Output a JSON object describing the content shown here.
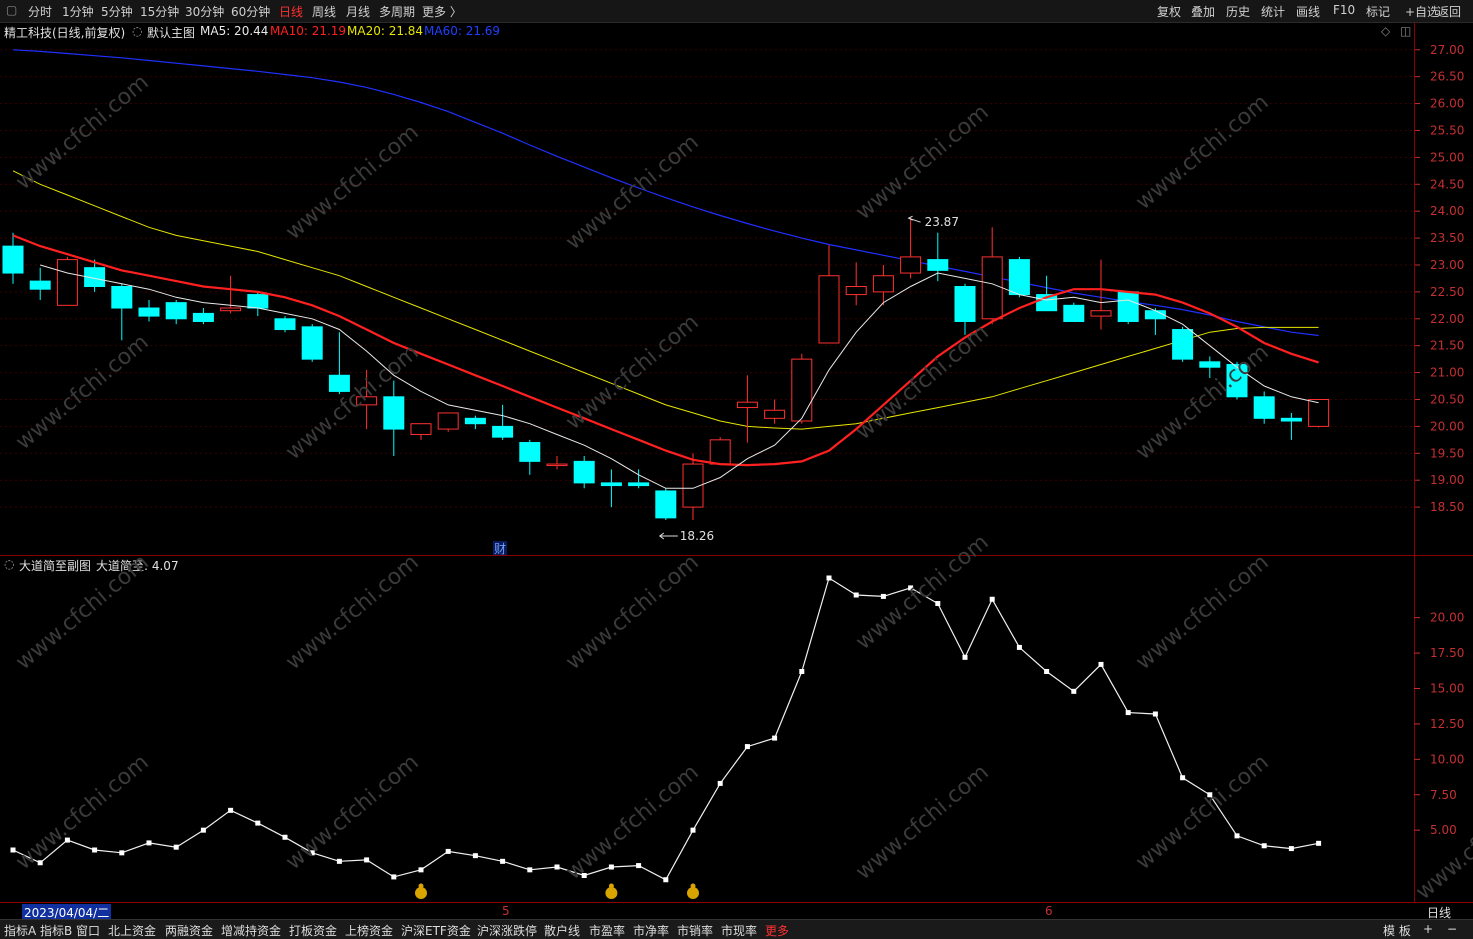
{
  "toolbar": {
    "left": [
      "分时",
      "1分钟",
      "5分钟",
      "15分钟",
      "30分钟",
      "60分钟",
      "日线",
      "周线",
      "月线",
      "多周期",
      "更多 〉"
    ],
    "active": "日线",
    "right": [
      "复权",
      "叠加",
      "历史",
      "统计",
      "画线",
      "F10",
      "标记",
      "+自选",
      "返回"
    ]
  },
  "main_info": {
    "stock": "精工科技(日线,前复权)",
    "template": "默认主图",
    "ma5": "MA5: 20.44",
    "ma10": "MA10: 21.19",
    "ma20": "MA20: 21.84",
    "ma60": "MA60: 21.69"
  },
  "sub_info": {
    "title": "大道简至副图",
    "value": "大道简至: 4.07"
  },
  "marks": {
    "high": "23.87",
    "low": "18.26",
    "cai": "财"
  },
  "datebar": {
    "left_date": "2023/04/04/二",
    "label_5": "5",
    "label_6": "6",
    "period": "日线"
  },
  "bottom_tabs": [
    "指标A",
    "指标B",
    "窗口",
    "北上资金",
    "两融资金",
    "增减持资金",
    "打板资金",
    "上榜资金",
    "沪深ETF资金",
    "沪深涨跌停",
    "散户线",
    "市盈率",
    "市净率",
    "市销率",
    "市现率",
    "更多"
  ],
  "bottom_right": [
    "模 板",
    "+",
    "−"
  ],
  "watermark": "www.cfchi.com",
  "colors": {
    "up": "#ff3030",
    "down": "#00ffff",
    "ma5": "#e8e8e8",
    "ma10": "#ff2020",
    "ma20": "#e6e600",
    "ma60": "#2030ff",
    "axis": "#c43030"
  },
  "chart_data": {
    "type": "candlestick",
    "ylim": [
      18.0,
      27.2
    ],
    "yticks": [
      18.5,
      19.0,
      19.5,
      20.0,
      20.5,
      21.0,
      21.5,
      22.0,
      22.5,
      23.0,
      23.5,
      24.0,
      24.5,
      25.0,
      25.5,
      26.0,
      26.5,
      27.0
    ],
    "candles": [
      [
        23.35,
        23.6,
        22.85,
        22.65
      ],
      [
        22.7,
        22.95,
        22.55,
        22.35
      ],
      [
        22.25,
        23.15,
        23.1,
        23.0
      ],
      [
        22.95,
        23.1,
        22.6,
        22.5
      ],
      [
        22.6,
        22.65,
        22.2,
        21.6
      ],
      [
        22.2,
        22.35,
        22.05,
        21.95
      ],
      [
        22.3,
        22.35,
        22.0,
        21.9
      ],
      [
        22.1,
        22.2,
        21.95,
        21.9
      ],
      [
        22.15,
        22.8,
        22.2,
        22.1
      ],
      [
        22.45,
        22.5,
        22.2,
        22.05
      ],
      [
        22.0,
        22.05,
        21.8,
        21.75
      ],
      [
        21.85,
        21.9,
        21.25,
        21.2
      ],
      [
        20.95,
        21.75,
        20.65,
        20.6
      ],
      [
        20.4,
        21.05,
        20.55,
        19.95
      ],
      [
        20.55,
        20.85,
        19.95,
        19.45
      ],
      [
        19.85,
        20.05,
        20.05,
        19.75
      ],
      [
        19.95,
        20.1,
        20.25,
        19.9
      ],
      [
        20.15,
        20.2,
        20.05,
        19.95
      ],
      [
        20.0,
        20.4,
        19.8,
        19.75
      ],
      [
        19.7,
        19.75,
        19.35,
        19.1
      ],
      [
        19.3,
        19.45,
        19.3,
        19.2
      ],
      [
        19.35,
        19.45,
        18.95,
        18.85
      ],
      [
        18.95,
        19.2,
        18.9,
        18.5
      ],
      [
        18.95,
        19.2,
        18.9,
        18.85
      ],
      [
        18.8,
        18.85,
        18.3,
        18.26
      ],
      [
        18.5,
        19.5,
        19.3,
        18.26
      ],
      [
        19.3,
        19.8,
        19.75,
        19.3
      ],
      [
        20.35,
        20.95,
        20.45,
        19.7
      ],
      [
        20.15,
        20.5,
        20.3,
        20.05
      ],
      [
        20.1,
        21.35,
        21.25,
        20.05
      ],
      [
        21.55,
        23.37,
        22.8,
        21.55
      ],
      [
        22.45,
        23.05,
        22.6,
        22.25
      ],
      [
        22.5,
        23.0,
        22.8,
        22.25
      ],
      [
        22.85,
        23.87,
        23.15,
        22.75
      ],
      [
        23.1,
        23.6,
        22.9,
        22.7
      ],
      [
        22.6,
        22.65,
        21.95,
        21.7
      ],
      [
        22.0,
        23.7,
        23.15,
        21.9
      ],
      [
        23.1,
        23.15,
        22.45,
        22.4
      ],
      [
        22.45,
        22.8,
        22.15,
        22.15
      ],
      [
        22.25,
        22.3,
        21.95,
        21.95
      ],
      [
        22.05,
        23.1,
        22.15,
        21.8
      ],
      [
        22.5,
        22.5,
        21.95,
        21.9
      ],
      [
        22.15,
        22.2,
        22.0,
        21.7
      ],
      [
        21.8,
        21.85,
        21.25,
        21.2
      ],
      [
        21.2,
        21.3,
        21.1,
        20.9
      ],
      [
        21.15,
        21.2,
        20.55,
        20.5
      ],
      [
        20.55,
        20.65,
        20.15,
        20.05
      ],
      [
        20.15,
        20.25,
        20.1,
        19.75
      ],
      [
        20.0,
        20.5,
        20.5,
        19.98
      ]
    ],
    "ma5": [
      null,
      23.0,
      22.85,
      22.75,
      22.65,
      22.55,
      22.4,
      22.3,
      22.25,
      22.2,
      22.1,
      22.0,
      21.8,
      21.4,
      20.95,
      20.65,
      20.4,
      20.3,
      20.2,
      20.05,
      19.85,
      19.65,
      19.4,
      19.1,
      18.85,
      18.85,
      19.05,
      19.4,
      19.65,
      20.15,
      21.05,
      21.75,
      22.3,
      22.6,
      22.85,
      22.75,
      22.65,
      22.45,
      22.35,
      22.4,
      22.3,
      22.35,
      22.15,
      21.9,
      21.5,
      21.1,
      20.75,
      20.55,
      20.44
    ],
    "ma10": [
      23.55,
      23.35,
      23.2,
      23.05,
      22.9,
      22.8,
      22.7,
      22.6,
      22.55,
      22.5,
      22.4,
      22.25,
      22.05,
      21.8,
      21.55,
      21.35,
      21.15,
      20.95,
      20.75,
      20.55,
      20.35,
      20.15,
      19.95,
      19.75,
      19.55,
      19.38,
      19.3,
      19.28,
      19.3,
      19.35,
      19.55,
      19.95,
      20.4,
      20.85,
      21.3,
      21.65,
      21.95,
      22.2,
      22.4,
      22.55,
      22.55,
      22.5,
      22.45,
      22.3,
      22.1,
      21.85,
      21.55,
      21.35,
      21.19
    ],
    "ma20": [
      24.75,
      24.5,
      24.3,
      24.1,
      23.9,
      23.7,
      23.55,
      23.45,
      23.35,
      23.25,
      23.1,
      22.95,
      22.8,
      22.6,
      22.4,
      22.2,
      22.0,
      21.8,
      21.6,
      21.4,
      21.2,
      21.0,
      20.8,
      20.6,
      20.4,
      20.25,
      20.1,
      20.0,
      19.97,
      19.95,
      20.0,
      20.05,
      20.15,
      20.25,
      20.35,
      20.45,
      20.55,
      20.7,
      20.85,
      21.0,
      21.15,
      21.3,
      21.45,
      21.6,
      21.75,
      21.82,
      21.84,
      21.84,
      21.84
    ],
    "ma60": [
      27.0,
      26.97,
      26.93,
      26.89,
      26.85,
      26.8,
      26.75,
      26.7,
      26.65,
      26.6,
      26.54,
      26.48,
      26.4,
      26.3,
      26.17,
      26.02,
      25.85,
      25.65,
      25.45,
      25.23,
      25.02,
      24.82,
      24.62,
      24.43,
      24.25,
      24.08,
      23.92,
      23.77,
      23.63,
      23.5,
      23.38,
      23.28,
      23.18,
      23.08,
      22.98,
      22.88,
      22.78,
      22.68,
      22.58,
      22.48,
      22.4,
      22.32,
      22.25,
      22.17,
      22.07,
      21.95,
      21.85,
      21.75,
      21.69
    ],
    "sub": {
      "name": "大道简至",
      "ylim": [
        0,
        24
      ],
      "yticks": [
        5.0,
        7.5,
        10.0,
        12.5,
        15.0,
        17.5,
        20.0
      ],
      "values": [
        3.6,
        2.7,
        4.3,
        3.6,
        3.4,
        4.1,
        3.8,
        5.0,
        6.4,
        5.5,
        4.5,
        3.4,
        2.8,
        2.9,
        1.7,
        2.2,
        3.5,
        3.2,
        2.8,
        2.2,
        2.4,
        1.8,
        2.4,
        2.5,
        1.5,
        5.0,
        8.3,
        10.9,
        11.5,
        16.2,
        22.8,
        21.6,
        21.5,
        22.1,
        21.0,
        17.2,
        21.3,
        17.9,
        16.2,
        14.8,
        16.7,
        13.3,
        13.2,
        8.7,
        7.5,
        4.6,
        3.9,
        3.7,
        4.07
      ]
    }
  }
}
